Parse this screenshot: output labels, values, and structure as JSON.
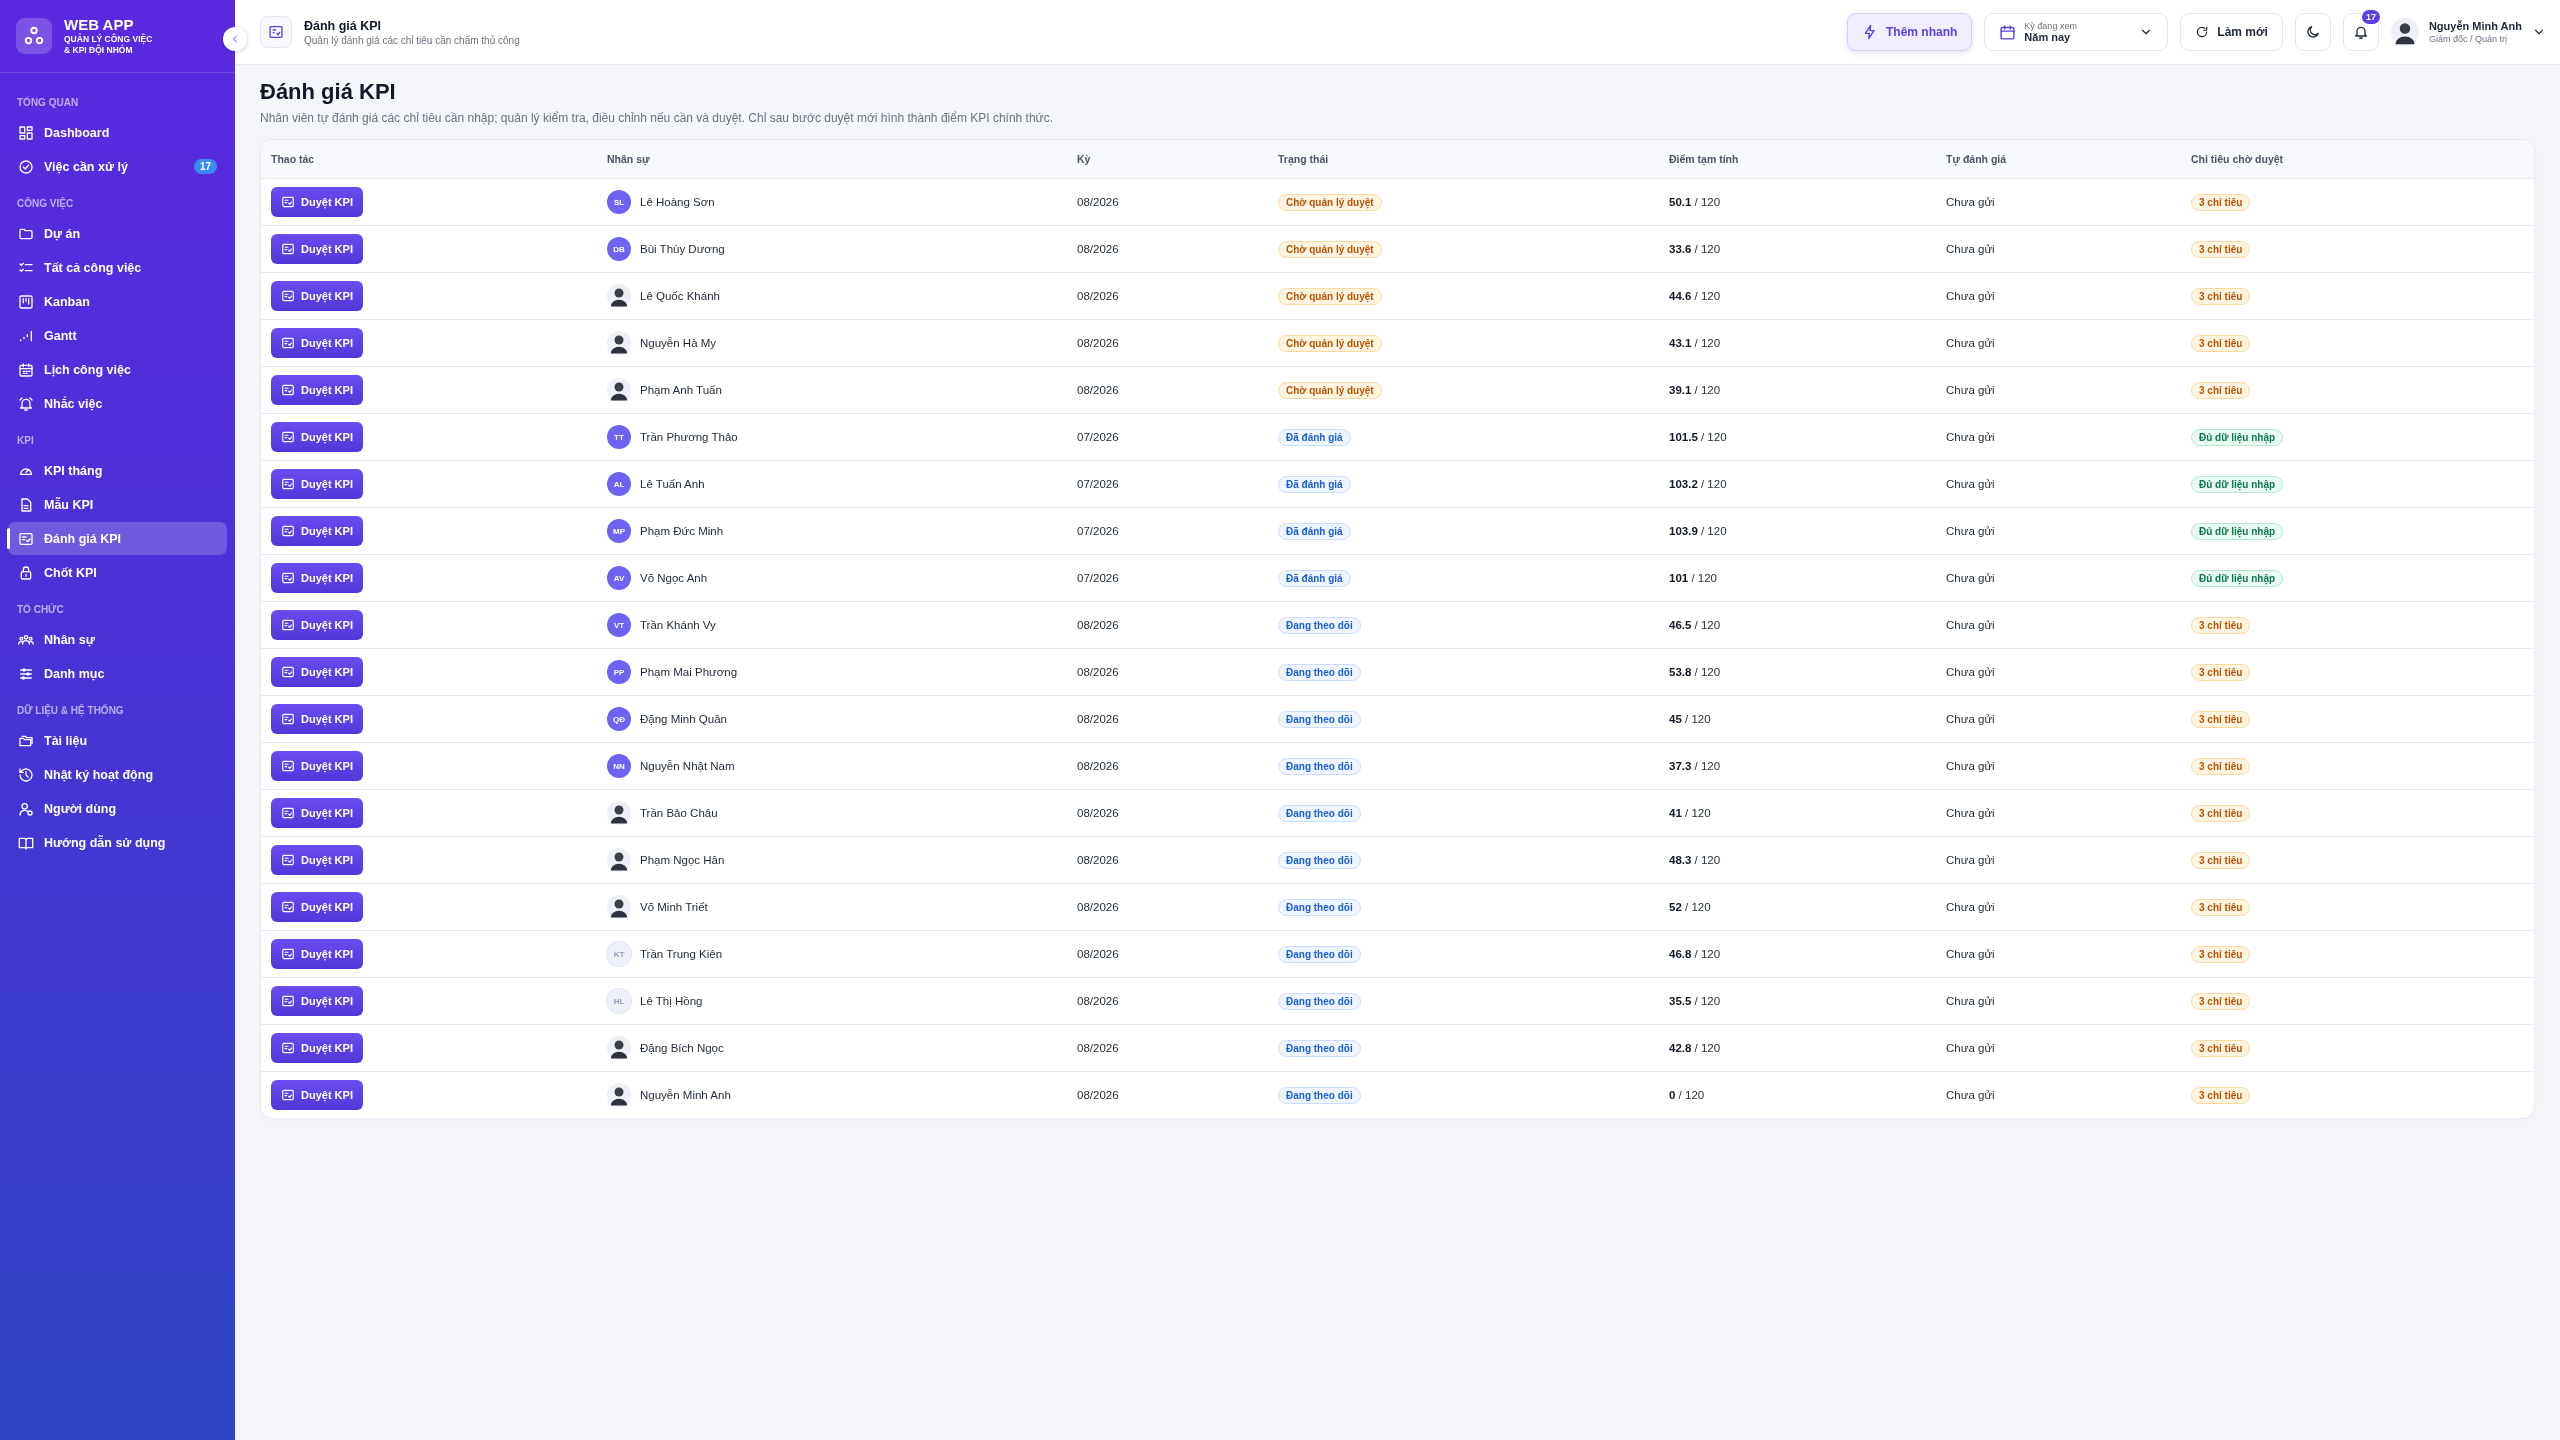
{
  "app": {
    "name": "WEB APP",
    "tagline_1": "QUẢN LÝ CÔNG VIỆC",
    "tagline_2": "& KPI ĐỘI NHÓM"
  },
  "sidebar": {
    "sections": [
      {
        "title": "TỔNG QUAN",
        "items": [
          {
            "label": "Dashboard",
            "selected": false
          },
          {
            "label": "Việc cần xử lý",
            "selected": false,
            "badge": "17"
          }
        ]
      },
      {
        "title": "CÔNG VIỆC",
        "items": [
          {
            "label": "Dự án",
            "selected": false
          },
          {
            "label": "Tất cả công việc",
            "selected": false
          },
          {
            "label": "Kanban",
            "selected": false
          },
          {
            "label": "Gantt",
            "selected": false
          },
          {
            "label": "Lịch công việc",
            "selected": false
          },
          {
            "label": "Nhắc việc",
            "selected": false
          }
        ]
      },
      {
        "title": "KPI",
        "items": [
          {
            "label": "KPI tháng",
            "selected": false
          },
          {
            "label": "Mẫu KPI",
            "selected": false
          },
          {
            "label": "Đánh giá KPI",
            "selected": true
          },
          {
            "label": "Chốt KPI",
            "selected": false
          }
        ]
      },
      {
        "title": "TỔ CHỨC",
        "items": [
          {
            "label": "Nhân sự",
            "selected": false
          },
          {
            "label": "Danh mục",
            "selected": false
          }
        ]
      },
      {
        "title": "DỮ LIỆU & HỆ THỐNG",
        "items": [
          {
            "label": "Tài liệu",
            "selected": false
          },
          {
            "label": "Nhật ký hoạt động",
            "selected": false
          },
          {
            "label": "Người dùng",
            "selected": false
          },
          {
            "label": "Hướng dẫn sử dụng",
            "selected": false
          }
        ]
      }
    ]
  },
  "header": {
    "title": "Đánh giá KPI",
    "subtitle": "Quản lý đánh giá các chỉ tiêu cần chấm thủ công",
    "quick_add": "Thêm nhanh",
    "period": {
      "label": "Kỳ đang xem",
      "value": "Năm nay"
    },
    "refresh": "Làm mới",
    "notification_count": "17",
    "user": {
      "name": "Nguyễn Minh Anh",
      "role": "Giám đốc / Quản trị"
    }
  },
  "page": {
    "title": "Đánh giá KPI",
    "description": "Nhân viên tự đánh giá các chỉ tiêu cần nhập; quản lý kiểm tra, điều chỉnh nếu cần và duyệt. Chỉ sau bước duyệt mới hình thành điểm KPI chính thức."
  },
  "table": {
    "columns": [
      "Thao tác",
      "Nhân sự",
      "Kỳ",
      "Trạng thái",
      "Điểm tạm tính",
      "Tự đánh giá",
      "Chỉ tiêu chờ duyệt"
    ],
    "rows": [
      {
        "action": "Duyệt KPI",
        "avatar": {
          "kind": "initials",
          "text": "SL"
        },
        "name": "Lê Hoàng Sơn",
        "period": "08/2026",
        "status": {
          "kind": "pending",
          "text": "Chờ quản lý duyệt"
        },
        "score": "**50.1** / 120",
        "self": "Chưa gửi",
        "waiting": {
          "kind": "count",
          "text": "3 chỉ tiêu"
        }
      },
      {
        "action": "Duyệt KPI",
        "avatar": {
          "kind": "initials",
          "text": "DB"
        },
        "name": "Bùi Thùy Dương",
        "period": "08/2026",
        "status": {
          "kind": "pending",
          "text": "Chờ quản lý duyệt"
        },
        "score": "**33.6** / 120",
        "self": "Chưa gửi",
        "waiting": {
          "kind": "count",
          "text": "3 chỉ tiêu"
        }
      },
      {
        "action": "Duyệt KPI",
        "avatar": {
          "kind": "photo"
        },
        "name": "Lê Quốc Khánh",
        "period": "08/2026",
        "status": {
          "kind": "pending",
          "text": "Chờ quản lý duyệt"
        },
        "score": "**44.6** / 120",
        "self": "Chưa gửi",
        "waiting": {
          "kind": "count",
          "text": "3 chỉ tiêu"
        }
      },
      {
        "action": "Duyệt KPI",
        "avatar": {
          "kind": "photo"
        },
        "name": "Nguyễn Hà My",
        "period": "08/2026",
        "status": {
          "kind": "pending",
          "text": "Chờ quản lý duyệt"
        },
        "score": "**43.1** / 120",
        "self": "Chưa gửi",
        "waiting": {
          "kind": "count",
          "text": "3 chỉ tiêu"
        }
      },
      {
        "action": "Duyệt KPI",
        "avatar": {
          "kind": "photo"
        },
        "name": "Phạm Anh Tuấn",
        "period": "08/2026",
        "status": {
          "kind": "pending",
          "text": "Chờ quản lý duyệt"
        },
        "score": "**39.1** / 120",
        "self": "Chưa gửi",
        "waiting": {
          "kind": "count",
          "text": "3 chỉ tiêu"
        }
      },
      {
        "action": "Duyệt KPI",
        "avatar": {
          "kind": "initials",
          "text": "TT"
        },
        "name": "Trần Phương Thảo",
        "period": "07/2026",
        "status": {
          "kind": "evaluated",
          "text": "Đã đánh giá"
        },
        "score": "**101.5** / 120",
        "self": "Chưa gửi",
        "waiting": {
          "kind": "complete",
          "text": "Đủ dữ liệu nhập"
        }
      },
      {
        "action": "Duyệt KPI",
        "avatar": {
          "kind": "initials",
          "text": "AL"
        },
        "name": "Lê Tuấn Anh",
        "period": "07/2026",
        "status": {
          "kind": "evaluated",
          "text": "Đã đánh giá"
        },
        "score": "**103.2** / 120",
        "self": "Chưa gửi",
        "waiting": {
          "kind": "complete",
          "text": "Đủ dữ liệu nhập"
        }
      },
      {
        "action": "Duyệt KPI",
        "avatar": {
          "kind": "initials",
          "text": "MP"
        },
        "name": "Phạm Đức Minh",
        "period": "07/2026",
        "status": {
          "kind": "evaluated",
          "text": "Đã đánh giá"
        },
        "score": "**103.9** / 120",
        "self": "Chưa gửi",
        "waiting": {
          "kind": "complete",
          "text": "Đủ dữ liệu nhập"
        }
      },
      {
        "action": "Duyệt KPI",
        "avatar": {
          "kind": "initials",
          "text": "AV"
        },
        "name": "Võ Ngọc Anh",
        "period": "07/2026",
        "status": {
          "kind": "evaluated",
          "text": "Đã đánh giá"
        },
        "score": "**101** / 120",
        "self": "Chưa gửi",
        "waiting": {
          "kind": "complete",
          "text": "Đủ dữ liệu nhập"
        }
      },
      {
        "action": "Duyệt KPI",
        "avatar": {
          "kind": "initials",
          "text": "VT"
        },
        "name": "Trần Khánh Vy",
        "period": "08/2026",
        "status": {
          "kind": "tracking",
          "text": "Đang theo dõi"
        },
        "score": "**46.5** / 120",
        "self": "Chưa gửi",
        "waiting": {
          "kind": "count",
          "text": "3 chỉ tiêu"
        }
      },
      {
        "action": "Duyệt KPI",
        "avatar": {
          "kind": "initials",
          "text": "PP"
        },
        "name": "Phạm Mai Phương",
        "period": "08/2026",
        "status": {
          "kind": "tracking",
          "text": "Đang theo dõi"
        },
        "score": "**53.8** / 120",
        "self": "Chưa gửi",
        "waiting": {
          "kind": "count",
          "text": "3 chỉ tiêu"
        }
      },
      {
        "action": "Duyệt KPI",
        "avatar": {
          "kind": "initials",
          "text": "QĐ"
        },
        "name": "Đặng Minh Quân",
        "period": "08/2026",
        "status": {
          "kind": "tracking",
          "text": "Đang theo dõi"
        },
        "score": "**45** / 120",
        "self": "Chưa gửi",
        "waiting": {
          "kind": "count",
          "text": "3 chỉ tiêu"
        }
      },
      {
        "action": "Duyệt KPI",
        "avatar": {
          "kind": "initials",
          "text": "NN"
        },
        "name": "Nguyễn Nhật Nam",
        "period": "08/2026",
        "status": {
          "kind": "tracking",
          "text": "Đang theo dõi"
        },
        "score": "**37.3** / 120",
        "self": "Chưa gửi",
        "waiting": {
          "kind": "count",
          "text": "3 chỉ tiêu"
        }
      },
      {
        "action": "Duyệt KPI",
        "avatar": {
          "kind": "photo"
        },
        "name": "Trần Bảo Châu",
        "period": "08/2026",
        "status": {
          "kind": "tracking",
          "text": "Đang theo dõi"
        },
        "score": "**41** / 120",
        "self": "Chưa gửi",
        "waiting": {
          "kind": "count",
          "text": "3 chỉ tiêu"
        }
      },
      {
        "action": "Duyệt KPI",
        "avatar": {
          "kind": "photo"
        },
        "name": "Phạm Ngọc Hân",
        "period": "08/2026",
        "status": {
          "kind": "tracking",
          "text": "Đang theo dõi"
        },
        "score": "**48.3** / 120",
        "self": "Chưa gửi",
        "waiting": {
          "kind": "count",
          "text": "3 chỉ tiêu"
        }
      },
      {
        "action": "Duyệt KPI",
        "avatar": {
          "kind": "photo"
        },
        "name": "Võ Minh Triết",
        "period": "08/2026",
        "status": {
          "kind": "tracking",
          "text": "Đang theo dõi"
        },
        "score": "**52** / 120",
        "self": "Chưa gửi",
        "waiting": {
          "kind": "count",
          "text": "3 chỉ tiêu"
        }
      },
      {
        "action": "Duyệt KPI",
        "avatar": {
          "kind": "faded",
          "text": "KT"
        },
        "name": "Trần Trung Kiên",
        "period": "08/2026",
        "status": {
          "kind": "tracking",
          "text": "Đang theo dõi"
        },
        "score": "**46.8** / 120",
        "self": "Chưa gửi",
        "waiting": {
          "kind": "count",
          "text": "3 chỉ tiêu"
        }
      },
      {
        "action": "Duyệt KPI",
        "avatar": {
          "kind": "faded",
          "text": "HL"
        },
        "name": "Lê Thị Hồng",
        "period": "08/2026",
        "status": {
          "kind": "tracking",
          "text": "Đang theo dõi"
        },
        "score": "**35.5** / 120",
        "self": "Chưa gửi",
        "waiting": {
          "kind": "count",
          "text": "3 chỉ tiêu"
        }
      },
      {
        "action": "Duyệt KPI",
        "avatar": {
          "kind": "photo"
        },
        "name": "Đặng Bích Ngọc",
        "period": "08/2026",
        "status": {
          "kind": "tracking",
          "text": "Đang theo dõi"
        },
        "score": "**42.8** / 120",
        "self": "Chưa gửi",
        "waiting": {
          "kind": "count",
          "text": "3 chỉ tiêu"
        }
      },
      {
        "action": "Duyệt KPI",
        "avatar": {
          "kind": "photo"
        },
        "name": "Nguyễn Minh Anh",
        "period": "08/2026",
        "status": {
          "kind": "tracking",
          "text": "Đang theo dõi"
        },
        "score": "**0** / 120",
        "self": "Chưa gửi",
        "waiting": {
          "kind": "count",
          "text": "3 chỉ tiêu"
        }
      }
    ]
  }
}
